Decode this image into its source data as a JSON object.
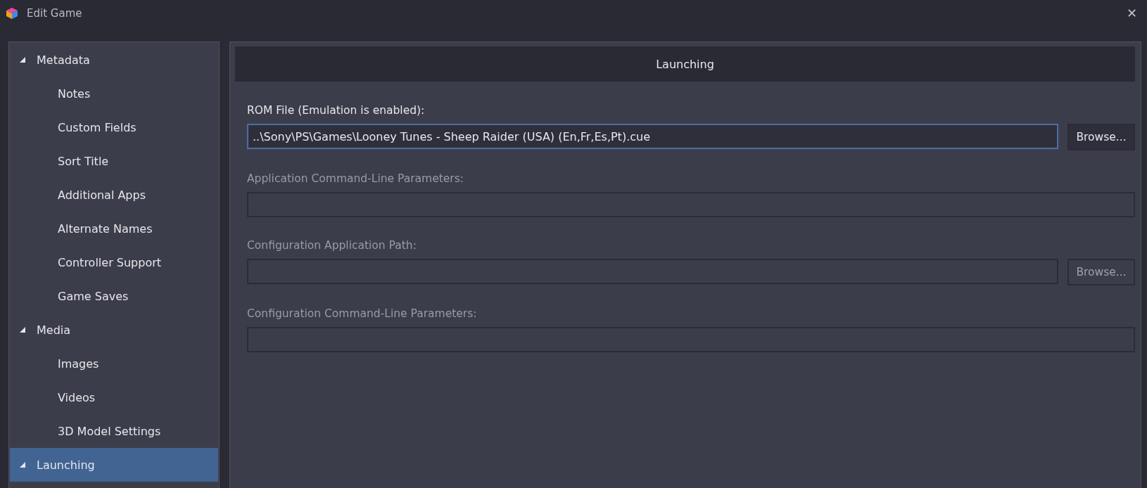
{
  "window": {
    "title": "Edit Game",
    "close": "✕"
  },
  "sidebar": {
    "items": [
      {
        "label": "Metadata",
        "expanded": true,
        "selected": false,
        "children": [
          {
            "label": "Notes",
            "selected": false
          },
          {
            "label": "Custom Fields",
            "selected": false
          },
          {
            "label": "Sort Title",
            "selected": false
          },
          {
            "label": "Additional Apps",
            "selected": false
          },
          {
            "label": "Alternate Names",
            "selected": false
          },
          {
            "label": "Controller Support",
            "selected": false
          },
          {
            "label": "Game Saves",
            "selected": false
          }
        ]
      },
      {
        "label": "Media",
        "expanded": true,
        "selected": false,
        "children": [
          {
            "label": "Images",
            "selected": false
          },
          {
            "label": "Videos",
            "selected": false
          },
          {
            "label": "3D Model Settings",
            "selected": false
          }
        ]
      },
      {
        "label": "Launching",
        "expanded": true,
        "selected": true
      }
    ]
  },
  "panel": {
    "title": "Launching",
    "fields": [
      {
        "label": "ROM File (Emulation is enabled):",
        "value": "..\\Sony\\PS\\Games\\Looney Tunes - Sheep Raider (USA) (En,Fr,Es,Pt).cue",
        "disabled": false,
        "focused": true,
        "browse": "Browse..."
      },
      {
        "label": "Application Command-Line Parameters:",
        "disabled": true,
        "focused": false
      },
      {
        "label": "Configuration Application Path:",
        "disabled": true,
        "focused": false,
        "browse": "Browse..."
      },
      {
        "label": "Configuration Command-Line Parameters:",
        "disabled": true,
        "focused": false
      }
    ]
  }
}
